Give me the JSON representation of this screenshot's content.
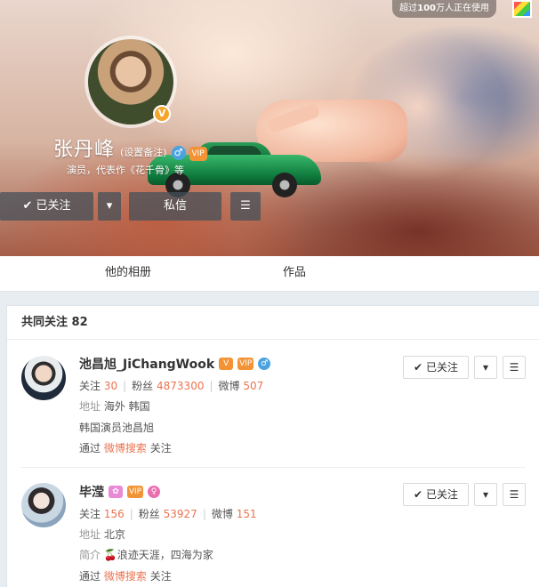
{
  "top_badge": {
    "prefix": "超过",
    "count": "100",
    "suffix": "万人正在使用"
  },
  "profile": {
    "name": "张丹峰",
    "remark": "(设置备注)",
    "intro": "演员，代表作《花千骨》等",
    "follow_label": "已关注",
    "message_label": "私信"
  },
  "tabs": [
    {
      "label": "他的相册"
    },
    {
      "label": "作品"
    }
  ],
  "common_follow": {
    "title": "共同关注",
    "count": "82",
    "users": [
      {
        "name": "池昌旭_JiChangWook",
        "follow_label": "关注",
        "follow_count": "30",
        "fans_label": "粉丝",
        "fans_count": "4873300",
        "weibo_label": "微博",
        "weibo_count": "507",
        "location_label": "地址",
        "location": "海外 韩国",
        "bio": "韩国演员池昌旭",
        "via_prefix": "通过",
        "via_link": "微博搜索",
        "via_suffix": "关注",
        "button_label": "已关注"
      },
      {
        "name": "毕滢",
        "follow_label": "关注",
        "follow_count": "156",
        "fans_label": "粉丝",
        "fans_count": "53927",
        "weibo_label": "微博",
        "weibo_count": "151",
        "location_label": "地址",
        "location": "北京",
        "bio_label": "简介",
        "bio": "🍒浪迹天涯，四海为家",
        "via_prefix": "通过",
        "via_link": "微博搜索",
        "via_suffix": "关注",
        "button_label": "已关注"
      }
    ]
  },
  "colors": {
    "accent": "#eb7350",
    "cover_button": "#46505a"
  }
}
